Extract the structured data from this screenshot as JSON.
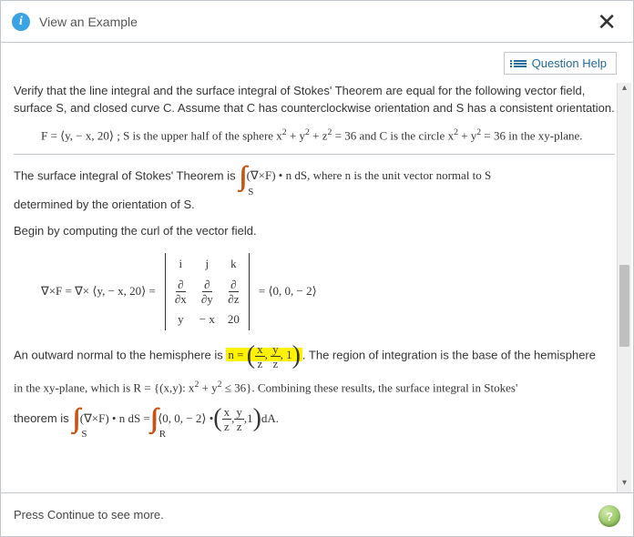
{
  "header": {
    "title": "View an Example",
    "info_glyph": "i",
    "close_glyph": "✕"
  },
  "toolbar": {
    "question_help": "Question Help"
  },
  "problem": {
    "intro": "Verify that the line integral and the surface integral of Stokes' Theorem are equal for the following vector field, surface S, and closed curve C. Assume that C has counterclockwise orientation and S has a consistent orientation.",
    "F_prefix": "F = ",
    "F_vec": "⟨y, − x, 20⟩",
    "F_rest1": " ; S is the upper half of the sphere x",
    "F_rest2": " + y",
    "F_rest3": " + z",
    "F_rest4": " = 36 and C is the circle x",
    "F_rest5": " + y",
    "F_rest6": " = 36 in the xy-plane.",
    "sq": "2"
  },
  "solution": {
    "s1a": "The surface integral of Stokes' Theorem is ",
    "s1b": "(∇×F) • n dS, where n is the unit vector normal to S",
    "s1c": "determined by the orientation of S.",
    "s2": "Begin by computing the curl of the vector field.",
    "curl_lhs": "∇×F = ∇× ⟨y, − x, 20⟩ =",
    "det": {
      "r1c1": "i",
      "r1c2": "j",
      "r1c3": "k",
      "r2c1": "∂x",
      "r2c2": "∂y",
      "r2c3": "∂z",
      "r3c1": "y",
      "r3c2": "− x",
      "r3c3": "20"
    },
    "curl_rhs": "= ⟨0, 0, − 2⟩",
    "s3a": "An outward normal to the hemisphere is ",
    "n_eq": "n = ",
    "frac1n": "x",
    "frac1d": "z",
    "frac2n": "y",
    "frac2d": "z",
    "one": "1",
    "s3b": ". The region of integration is the base of the hemisphere",
    "s4a": "in the xy-plane, which is R = {(x,y): x",
    "s4b": " + y",
    "s4c": " ≤ 36}. Combining these results, the surface integral in Stokes'",
    "s5a": "theorem is ",
    "s5b": "(∇×F) • n dS = ",
    "s5c": " ⟨0, 0, − 2⟩ • ",
    "s5d": " dA.",
    "sub_S": "S",
    "sub_R": "R"
  },
  "footer": {
    "continue_msg": "Press Continue to see more.",
    "help_glyph": "?"
  }
}
